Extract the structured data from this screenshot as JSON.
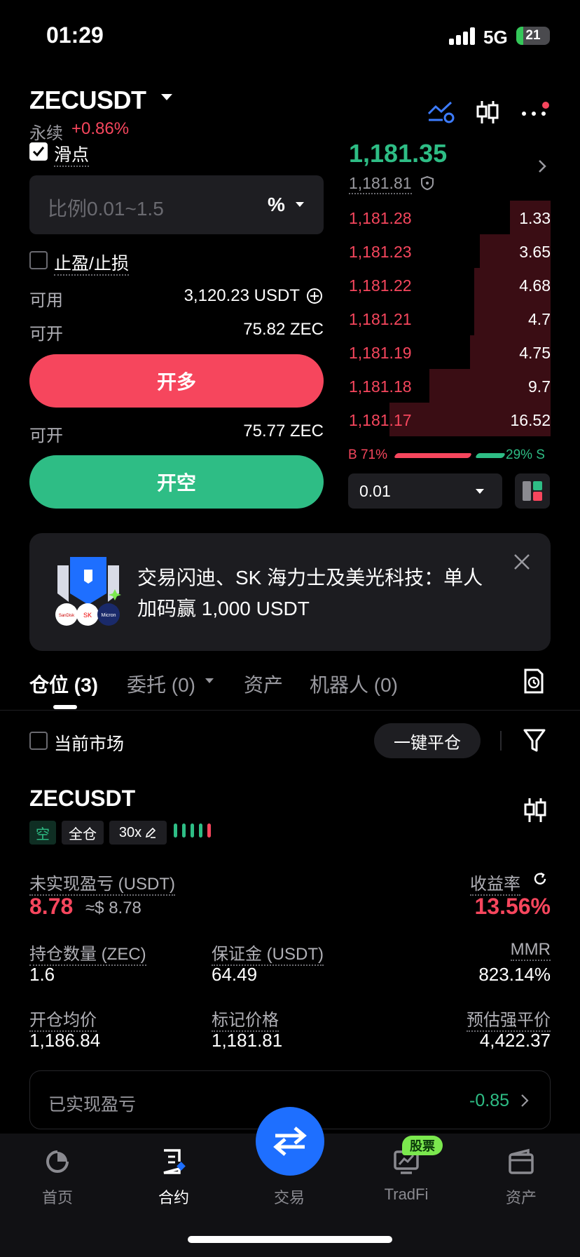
{
  "status_bar": {
    "time": "01:29",
    "network": "5G",
    "battery": "21"
  },
  "header": {
    "symbol": "ZECUSDT",
    "contract_type": "永续",
    "change": "+0.86%"
  },
  "order_form": {
    "slippage_label": "滑点",
    "ratio_placeholder": "比例0.01~1.5",
    "ratio_unit": "%",
    "tpsl_label": "止盈/止损",
    "available_label": "可用",
    "available_value": "3,120.23 USDT",
    "open_long_label": "可开",
    "open_long_value": "75.82 ZEC",
    "long_button": "开多",
    "open_short_label": "可开",
    "open_short_value": "75.77 ZEC",
    "short_button": "开空"
  },
  "order_book": {
    "last_price": "1,181.35",
    "mark_price": "1,181.81",
    "asks": [
      {
        "price": "1,181.28",
        "qty": "1.33",
        "depth": 0.2
      },
      {
        "price": "1,181.23",
        "qty": "3.65",
        "depth": 0.35
      },
      {
        "price": "1,181.22",
        "qty": "4.68",
        "depth": 0.38
      },
      {
        "price": "1,181.21",
        "qty": "4.7",
        "depth": 0.38
      },
      {
        "price": "1,181.19",
        "qty": "4.75",
        "depth": 0.4
      },
      {
        "price": "1,181.18",
        "qty": "9.7",
        "depth": 0.6
      },
      {
        "price": "1,181.17",
        "qty": "16.52",
        "depth": 0.8
      }
    ],
    "buy_ratio": "B 71%",
    "sell_ratio": "29% S",
    "depth_precision": "0.01"
  },
  "banner": {
    "text": "交易闪迪、SK 海力士及美光科技：单人加码赢 1,000 USDT"
  },
  "tabs": [
    {
      "label": "仓位 (3)"
    },
    {
      "label": "委托 (0)"
    },
    {
      "label": "资产"
    },
    {
      "label": "机器人 (0)"
    }
  ],
  "filters": {
    "current_market_label": "当前市场",
    "close_all_button": "一键平仓"
  },
  "position": {
    "symbol": "ZECUSDT",
    "side": "空",
    "margin_mode": "全仓",
    "leverage": "30x",
    "unrealized_pnl_label": "未实现盈亏 (USDT)",
    "unrealized_pnl": "8.78",
    "unrealized_pnl_usd": "≈$ 8.78",
    "roe_label": "收益率",
    "roe": "13.56%",
    "size_label": "持仓数量 (ZEC)",
    "size": "1.6",
    "margin_label": "保证金 (USDT)",
    "margin": "64.49",
    "mmr_label": "MMR",
    "mmr": "823.14%",
    "entry_label": "开仓均价",
    "entry": "1,186.84",
    "mark_label": "标记价格",
    "mark": "1,181.81",
    "liq_label": "预估强平价",
    "liq": "4,422.37",
    "realized_label": "已实现盈亏",
    "realized": "-0.85"
  },
  "bottom_nav": [
    {
      "label": "首页",
      "icon": "home-icon"
    },
    {
      "label": "合约",
      "icon": "contract-icon"
    },
    {
      "label": "交易",
      "icon": "swap-icon"
    },
    {
      "label": "TradFi",
      "icon": "tradfi-icon"
    },
    {
      "label": "资产",
      "icon": "wallet-icon"
    }
  ],
  "tradfi_badge": "股票",
  "colors": {
    "up": "#2ebd85",
    "down": "#f6465d",
    "accent": "#1e6fff"
  }
}
